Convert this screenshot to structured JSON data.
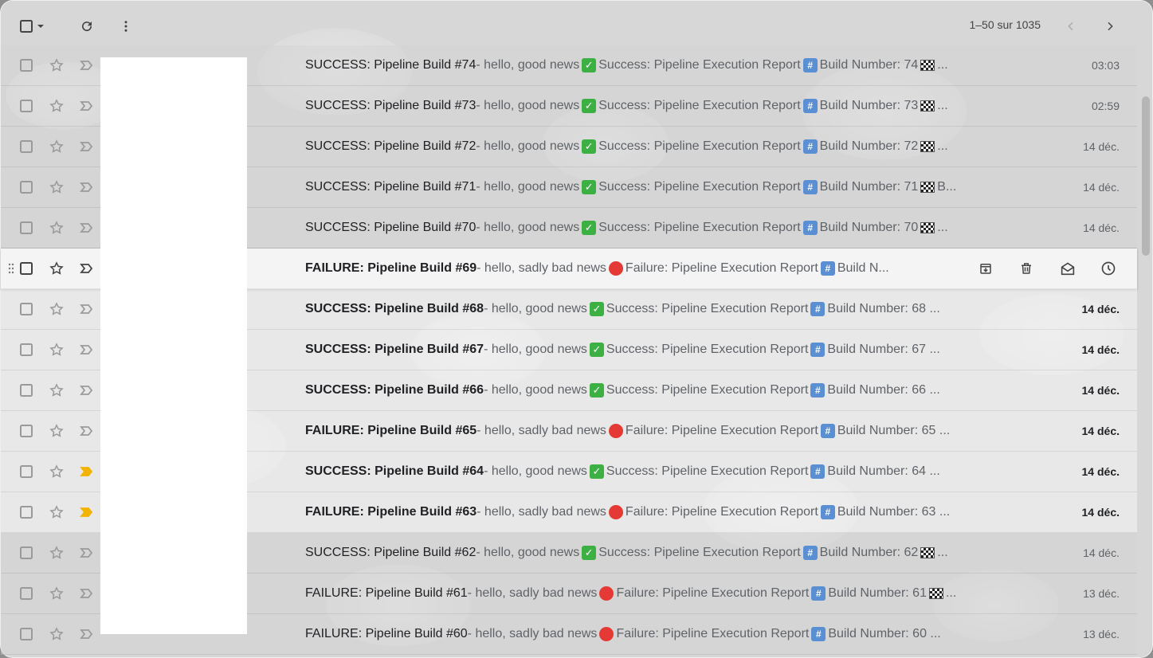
{
  "toolbar": {
    "pager_text": "1–50 sur 1035"
  },
  "icons": {
    "select_all": "checkbox-icon",
    "select_dropdown": "chevron-down-icon",
    "refresh": "refresh-icon",
    "more": "more-vert-icon",
    "prev": "chevron-left-icon",
    "next": "chevron-right-icon"
  },
  "colors": {
    "important_marker": "#f2b400",
    "success_emoji": "#3cb043",
    "failure_emoji": "#e53935"
  },
  "emails": [
    {
      "subject": "SUCCESS: Pipeline Build #74",
      "snippet_prefix": " - hello, good news ",
      "status": "success",
      "snippet_body": " Success: Pipeline Execution Report ",
      "snippet_tail": " Build Number: 74 ",
      "flag": true,
      "end": " ...",
      "date": "03:03",
      "unread": false,
      "important": false
    },
    {
      "subject": "SUCCESS: Pipeline Build #73",
      "snippet_prefix": " - hello, good news ",
      "status": "success",
      "snippet_body": " Success: Pipeline Execution Report ",
      "snippet_tail": " Build Number: 73 ",
      "flag": true,
      "end": " ...",
      "date": "02:59",
      "unread": false,
      "important": false
    },
    {
      "subject": "SUCCESS: Pipeline Build #72",
      "snippet_prefix": " - hello, good news ",
      "status": "success",
      "snippet_body": " Success: Pipeline Execution Report ",
      "snippet_tail": " Build Number: 72 ",
      "flag": true,
      "end": " ...",
      "date": "14 déc.",
      "unread": false,
      "important": false
    },
    {
      "subject": "SUCCESS: Pipeline Build #71",
      "snippet_prefix": " - hello, good news ",
      "status": "success",
      "snippet_body": " Success: Pipeline Execution Report ",
      "snippet_tail": " Build Number: 71 ",
      "flag": true,
      "end": " B...",
      "date": "14 déc.",
      "unread": false,
      "important": false
    },
    {
      "subject": "SUCCESS: Pipeline Build #70",
      "snippet_prefix": " - hello, good news ",
      "status": "success",
      "snippet_body": " Success: Pipeline Execution Report ",
      "snippet_tail": " Build Number: 70 ",
      "flag": true,
      "end": " ...",
      "date": "14 déc.",
      "unread": false,
      "important": false
    },
    {
      "subject": "FAILURE: Pipeline Build #69",
      "snippet_prefix": " - hello, sadly bad news ",
      "status": "failure",
      "snippet_body": " Failure: Pipeline Execution Report ",
      "snippet_tail": " Build N...",
      "flag": false,
      "end": "",
      "date": "",
      "unread": true,
      "important": false,
      "hover": true
    },
    {
      "subject": "SUCCESS: Pipeline Build #68",
      "snippet_prefix": " - hello, good news ",
      "status": "success",
      "snippet_body": " Success: Pipeline Execution Report ",
      "snippet_tail": " Build Number: 68 ...",
      "flag": false,
      "end": "",
      "date": "14 déc.",
      "unread": true,
      "important": false
    },
    {
      "subject": "SUCCESS: Pipeline Build #67",
      "snippet_prefix": " - hello, good news ",
      "status": "success",
      "snippet_body": " Success: Pipeline Execution Report ",
      "snippet_tail": " Build Number: 67 ...",
      "flag": false,
      "end": "",
      "date": "14 déc.",
      "unread": true,
      "important": false
    },
    {
      "subject": "SUCCESS: Pipeline Build #66",
      "snippet_prefix": " - hello, good news ",
      "status": "success",
      "snippet_body": " Success: Pipeline Execution Report ",
      "snippet_tail": " Build Number: 66 ...",
      "flag": false,
      "end": "",
      "date": "14 déc.",
      "unread": true,
      "important": false
    },
    {
      "subject": "FAILURE: Pipeline Build #65",
      "snippet_prefix": " - hello, sadly bad news ",
      "status": "failure",
      "snippet_body": " Failure: Pipeline Execution Report ",
      "snippet_tail": " Build Number: 65 ...",
      "flag": false,
      "end": "",
      "date": "14 déc.",
      "unread": true,
      "important": false
    },
    {
      "subject": "SUCCESS: Pipeline Build #64",
      "snippet_prefix": " - hello, good news ",
      "status": "success",
      "snippet_body": " Success: Pipeline Execution Report ",
      "snippet_tail": " Build Number: 64 ...",
      "flag": false,
      "end": "",
      "date": "14 déc.",
      "unread": true,
      "important": true
    },
    {
      "subject": "FAILURE: Pipeline Build #63",
      "snippet_prefix": " - hello, sadly bad news ",
      "status": "failure",
      "snippet_body": " Failure: Pipeline Execution Report ",
      "snippet_tail": " Build Number: 63 ...",
      "flag": false,
      "end": "",
      "date": "14 déc.",
      "unread": true,
      "important": true
    },
    {
      "subject": "SUCCESS: Pipeline Build #62",
      "snippet_prefix": " - hello, good news ",
      "status": "success",
      "snippet_body": " Success: Pipeline Execution Report ",
      "snippet_tail": " Build Number: 62 ",
      "flag": true,
      "end": " ...",
      "date": "14 déc.",
      "unread": false,
      "important": false
    },
    {
      "subject": "FAILURE: Pipeline Build #61",
      "snippet_prefix": " - hello, sadly bad news ",
      "status": "failure",
      "snippet_body": " Failure: Pipeline Execution Report ",
      "snippet_tail": " Build Number: 61 ",
      "flag": true,
      "end": " ...",
      "date": "13 déc.",
      "unread": false,
      "important": false
    },
    {
      "subject": "FAILURE: Pipeline Build #60",
      "snippet_prefix": " - hello, sadly bad news ",
      "status": "failure",
      "snippet_body": " Failure: Pipeline Execution Report ",
      "snippet_tail": " Build Number: 60 ...",
      "flag": false,
      "end": "",
      "date": "13 déc.",
      "unread": false,
      "important": false
    }
  ]
}
